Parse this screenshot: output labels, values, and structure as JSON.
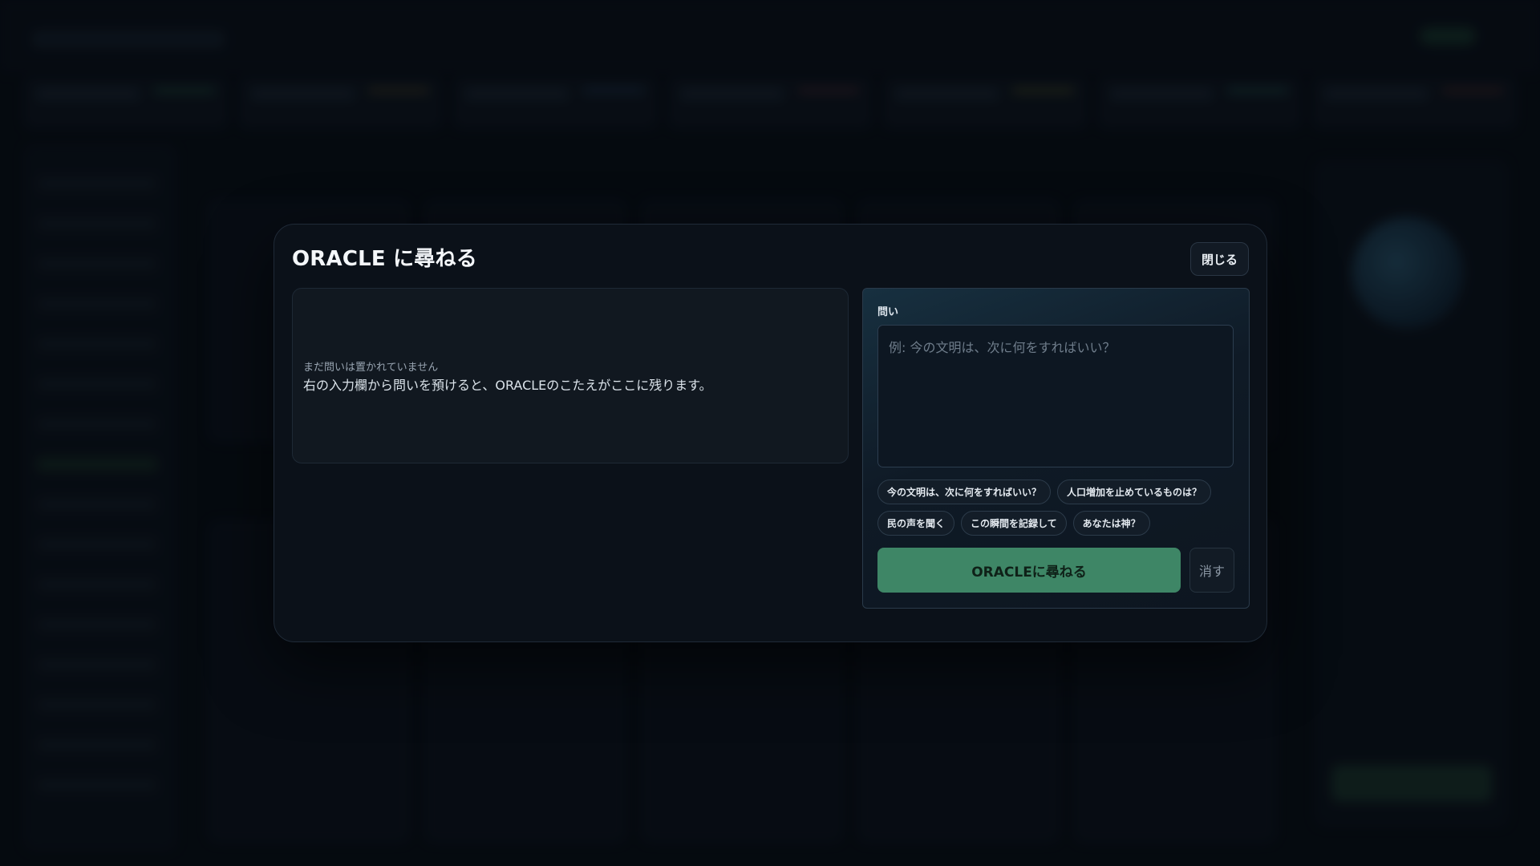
{
  "modal": {
    "title": "ORACLE に尋ねる",
    "close_label": "閉じる"
  },
  "answer": {
    "empty_label": "まだ問いは置かれていません",
    "empty_hint": "右の入力欄から問いを預けると、ORACLEのこたえがここに残ります。"
  },
  "ask": {
    "label": "問い",
    "question_value": "",
    "placeholder": "例: 今の文明は、次に何をすればいい？",
    "suggestions": [
      "今の文明は、次に何をすればいい？",
      "人口増加を止めているものは？",
      "民の声を聞く",
      "この瞬間を記録して",
      "あなたは神？"
    ],
    "submit_label": "ORACLEに尋ねる",
    "clear_label": "消す"
  },
  "colors": {
    "accent_green": "#3e8666",
    "panel_bg": "#0b1119"
  }
}
